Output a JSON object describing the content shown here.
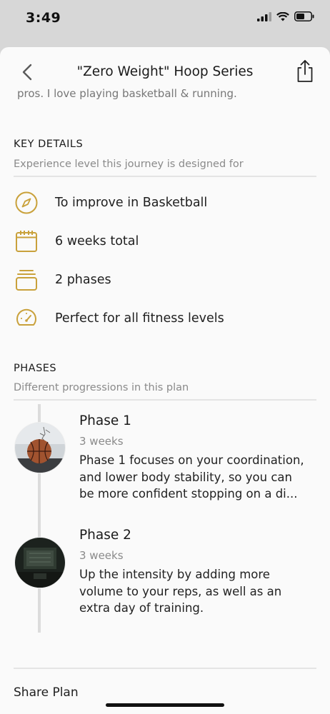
{
  "status_bar": {
    "time": "3:49"
  },
  "header": {
    "title": "\"Zero Weight\" Hoop Series"
  },
  "intro_clipped": "pros. I love playing basketball & running.",
  "key_details": {
    "title": "KEY DETAILS",
    "subtitle": "Experience level this journey is designed for",
    "items": [
      {
        "icon": "compass-icon",
        "label": "To improve in Basketball"
      },
      {
        "icon": "calendar-icon",
        "label": "6 weeks total"
      },
      {
        "icon": "layers-icon",
        "label": "2 phases"
      },
      {
        "icon": "gauge-icon",
        "label": "Perfect for all fitness levels"
      }
    ]
  },
  "phases": {
    "title": "PHASES",
    "subtitle": "Different progressions in this plan",
    "items": [
      {
        "name": "Phase 1",
        "duration": "3 weeks",
        "desc_1": "Phase 1 focuses on your coordination,",
        "desc_2": "and lower body stability, so you can",
        "desc_3": "be more confident stopping on a di..."
      },
      {
        "name": "Phase 2",
        "duration": "3 weeks",
        "desc_1": "Up the intensity by adding more",
        "desc_2": "volume to your reps, as well as an",
        "desc_3": "extra day of training."
      }
    ]
  },
  "footer": {
    "share_plan": "Share Plan"
  },
  "colors": {
    "accent": "#c9a13b",
    "background": "#fafafa",
    "muted": "#8a8a8a"
  }
}
